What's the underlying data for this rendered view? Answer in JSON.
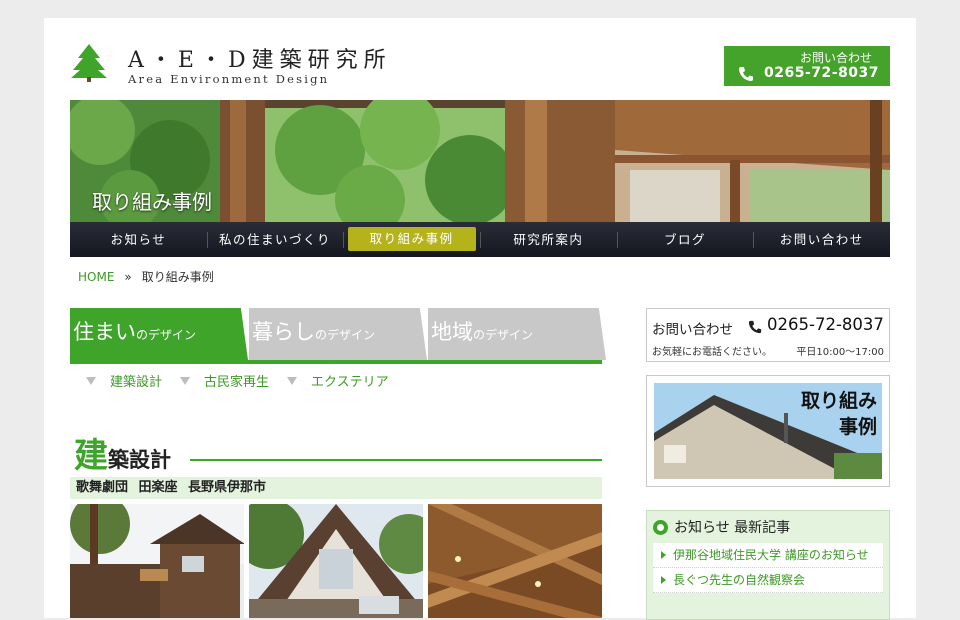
{
  "header": {
    "logo_title": "A・E・D建築研究所",
    "logo_sub": "Area Environment Design",
    "contact_label": "お問い合わせ",
    "contact_phone": "0265-72-8037"
  },
  "hero": {
    "caption": "取り組み事例"
  },
  "nav": {
    "items": [
      {
        "label": "お知らせ"
      },
      {
        "label": "私の住まいづくり"
      },
      {
        "label": "取り組み事例"
      },
      {
        "label": "研究所案内"
      },
      {
        "label": "ブログ"
      },
      {
        "label": "お問い合わせ"
      }
    ],
    "active_index": 2
  },
  "breadcrumb": {
    "home": "HOME",
    "separator": "»",
    "current": "取り組み事例"
  },
  "tabs": [
    {
      "big": "住まい",
      "small": "のデザイン"
    },
    {
      "big": "暮らし",
      "small": "のデザイン"
    },
    {
      "big": "地域",
      "small": "のデザイン"
    }
  ],
  "subcategories": [
    {
      "label": "建築設計"
    },
    {
      "label": "古民家再生"
    },
    {
      "label": "エクステリア"
    }
  ],
  "section": {
    "title_first": "建",
    "title_rest": "築設計",
    "project": "歌舞劇団 田楽座 長野県伊那市"
  },
  "sidebar": {
    "contact_title": "お問い合わせ",
    "contact_phone": "0265-72-8037",
    "contact_note": "お気軽にお電話ください。",
    "contact_hours": "平日10:00～17:00",
    "banner_line1": "取り組み",
    "banner_line2": "事例",
    "news_title": "お知らせ 最新記事",
    "news_items": [
      {
        "label": "伊那谷地域住民大学 講座のお知らせ"
      },
      {
        "label": "長ぐつ先生の自然観察会"
      }
    ]
  },
  "colors": {
    "accent": "#3fa42a",
    "nav_bg": "#1c1e28",
    "nav_active": "#b5b31c",
    "tab_inactive": "#c8c8c8"
  }
}
